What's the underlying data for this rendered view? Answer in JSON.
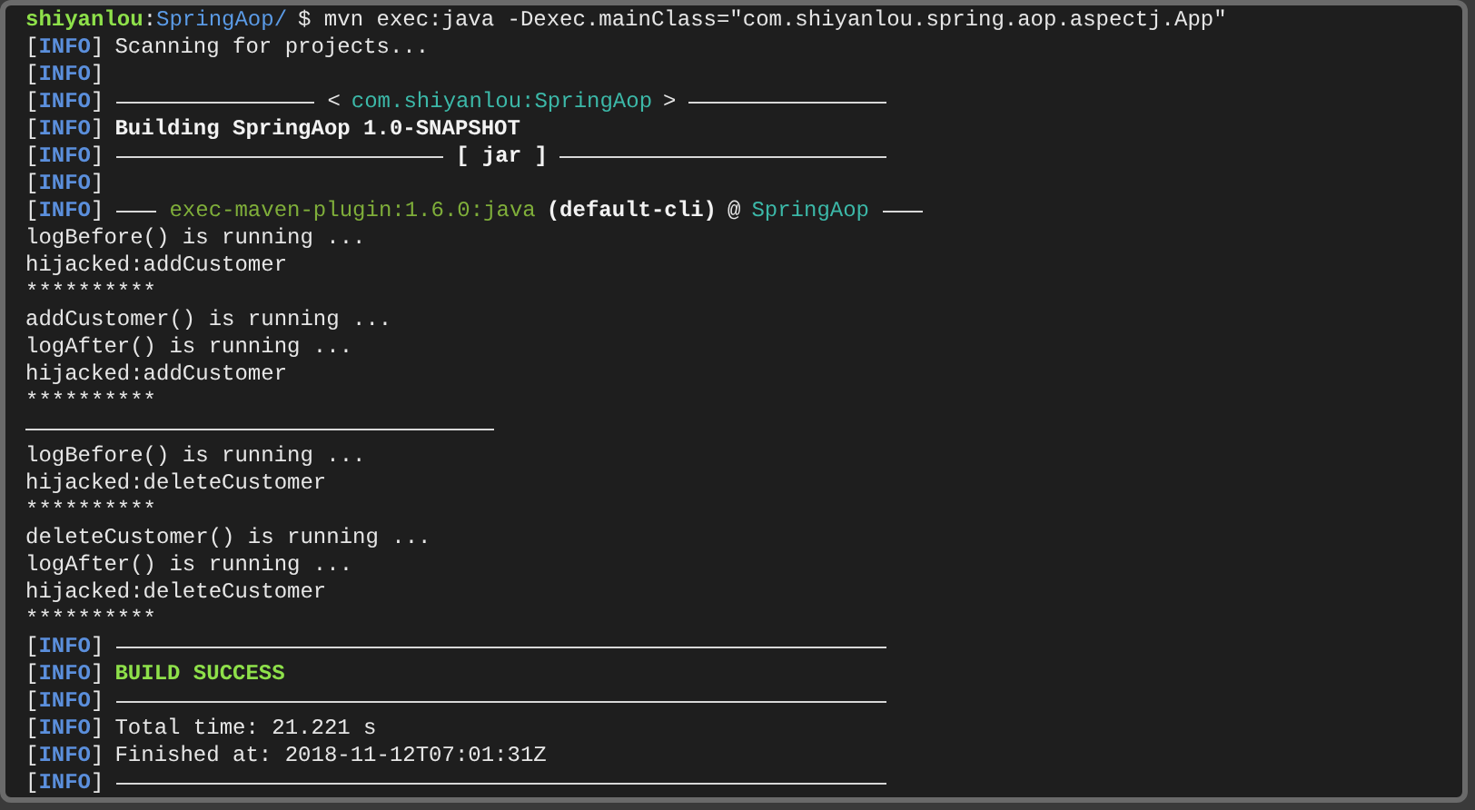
{
  "tag_brackets": {
    "open": "[",
    "close": "]"
  },
  "prompt": {
    "user": "shiyanlou",
    "separator": ":",
    "path": "SpringAop/",
    "command": "$ mvn exec:java -Dexec.mainClass=\"com.shiyanlou.spring.aop.aspectj.App\""
  },
  "lines": [
    {
      "kind": "info",
      "tag": "INFO",
      "parts": [
        {
          "kind": "plain",
          "text": "Scanning for projects..."
        }
      ]
    },
    {
      "kind": "info",
      "tag": "INFO"
    },
    {
      "kind": "info",
      "tag": "INFO",
      "parts": [
        {
          "kind": "rule"
        },
        {
          "kind": "plain",
          "text": "<"
        },
        {
          "kind": "module",
          "text": "com.shiyanlou:SpringAop"
        },
        {
          "kind": "plain",
          "text": ">"
        },
        {
          "kind": "rule"
        }
      ]
    },
    {
      "kind": "info",
      "tag": "INFO",
      "parts": [
        {
          "kind": "bold",
          "text": "Building SpringAop 1.0-SNAPSHOT"
        }
      ]
    },
    {
      "kind": "info",
      "tag": "INFO",
      "parts": [
        {
          "kind": "rule"
        },
        {
          "kind": "bold",
          "text": "[ jar ]"
        },
        {
          "kind": "rule"
        }
      ]
    },
    {
      "kind": "info",
      "tag": "INFO"
    },
    {
      "kind": "info",
      "tag": "INFO",
      "parts": [
        {
          "kind": "short-rule"
        },
        {
          "kind": "plugin",
          "text": "exec-maven-plugin:1.6.0:java"
        },
        {
          "kind": "bold",
          "text": "(default-cli)"
        },
        {
          "kind": "plain",
          "text": "@"
        },
        {
          "kind": "module",
          "text": "SpringAop"
        },
        {
          "kind": "short-rule"
        }
      ]
    },
    {
      "kind": "plain",
      "text": "logBefore() is running ..."
    },
    {
      "kind": "plain",
      "text": "hijacked:addCustomer"
    },
    {
      "kind": "plain",
      "text": "**********"
    },
    {
      "kind": "plain",
      "text": "addCustomer() is running ..."
    },
    {
      "kind": "plain",
      "text": "logAfter() is running ..."
    },
    {
      "kind": "plain",
      "text": "hijacked:addCustomer"
    },
    {
      "kind": "plain",
      "text": "**********"
    },
    {
      "kind": "rule"
    },
    {
      "kind": "plain",
      "text": "logBefore() is running ..."
    },
    {
      "kind": "plain",
      "text": "hijacked:deleteCustomer"
    },
    {
      "kind": "plain",
      "text": "**********"
    },
    {
      "kind": "plain",
      "text": "deleteCustomer() is running ..."
    },
    {
      "kind": "plain",
      "text": "logAfter() is running ..."
    },
    {
      "kind": "plain",
      "text": "hijacked:deleteCustomer"
    },
    {
      "kind": "plain",
      "text": "**********"
    },
    {
      "kind": "info",
      "tag": "INFO",
      "parts": [
        {
          "kind": "rule"
        }
      ]
    },
    {
      "kind": "info",
      "tag": "INFO",
      "parts": [
        {
          "kind": "success",
          "text": "BUILD SUCCESS"
        }
      ]
    },
    {
      "kind": "info",
      "tag": "INFO",
      "parts": [
        {
          "kind": "rule"
        }
      ]
    },
    {
      "kind": "info",
      "tag": "INFO",
      "parts": [
        {
          "kind": "plain",
          "text": "Total time: 21.221 s"
        }
      ]
    },
    {
      "kind": "info",
      "tag": "INFO",
      "parts": [
        {
          "kind": "plain",
          "text": "Finished at: 2018-11-12T07:01:31Z"
        }
      ]
    },
    {
      "kind": "info",
      "tag": "INFO",
      "parts": [
        {
          "kind": "rule"
        }
      ]
    }
  ]
}
